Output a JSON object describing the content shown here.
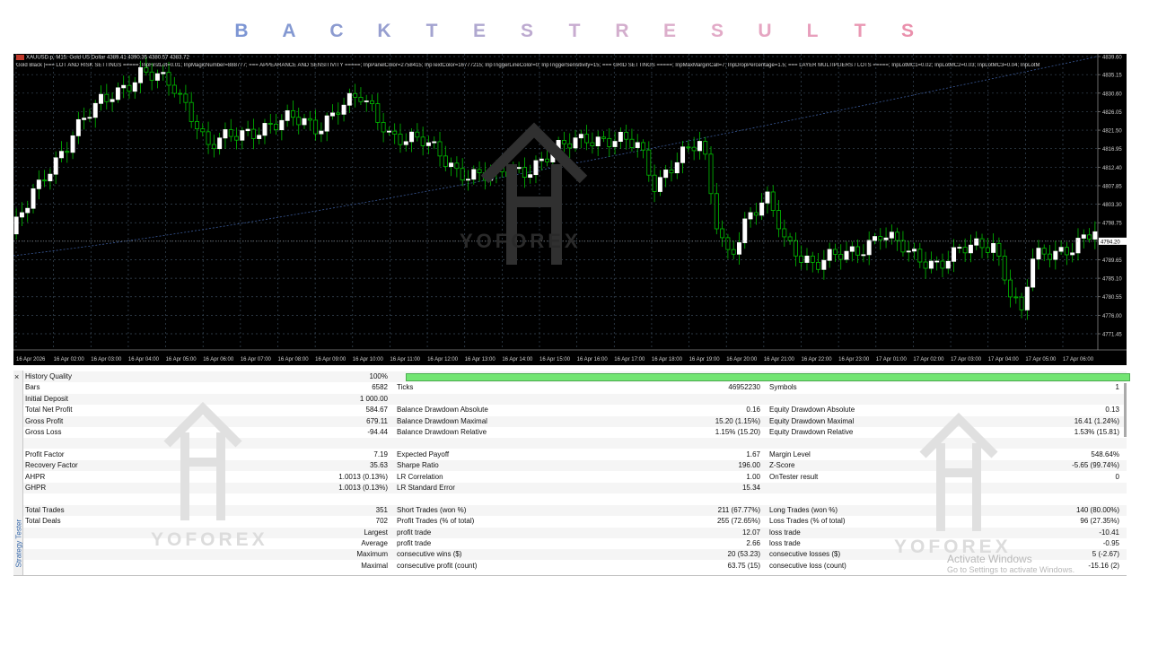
{
  "banner": {
    "letters": [
      "B",
      "A",
      "C",
      "K",
      "T",
      "E",
      "S",
      "T",
      "R",
      "E",
      "S",
      "U",
      "L",
      "T",
      "S"
    ],
    "colors": [
      "#7d96d4",
      "#8499d2",
      "#8c9bd0",
      "#979fd0",
      "#a3a3d0",
      "#b0a8d0",
      "#bdaad0",
      "#c8acd0",
      "#d3aecd",
      "#dcaecb",
      "#e2aac7",
      "#e6a6c2",
      "#e89fbc",
      "#ea98b4",
      "#ea90ac"
    ]
  },
  "chart": {
    "header": "XAUUSD.p, M15:  Gold US Dollar  4389.41 4390.35 4380.57 4383.72",
    "params": "Gold Black |=== LOT AND RISK SETTINGS =====; InpFirstLot=0.01; InpMagicNumber=888777; === APPEARANCE AND SENSITIVITY =====; InpPanelColor=2758415; InpTextColor=16777215; InpTriggerLineColor=0; InpTriggerSensitivity=15; === GRID SETTINGS =====; InpMaxMarginCall=7; InpDropPercentage=1.5; === LAYER MULTIPLIERS / LOTS =====; InpLotMC1=0.02; InpLotMC2=0.03; InpLotMC3=0.04; InpLotM",
    "price_labels": [
      "4839.60",
      "4835.15",
      "4830.60",
      "4826.05",
      "4821.50",
      "4816.95",
      "4812.40",
      "4807.85",
      "4803.30",
      "4798.75",
      "4794.20",
      "4789.65",
      "4785.10",
      "4780.55",
      "4776.00",
      "4771.45"
    ],
    "current_price": "4794.20",
    "time_labels": [
      "16 Apr 2026",
      "16 Apr 02:00",
      "16 Apr 03:00",
      "16 Apr 04:00",
      "16 Apr 05:00",
      "16 Apr 06:00",
      "16 Apr 07:00",
      "16 Apr 08:00",
      "16 Apr 09:00",
      "16 Apr 10:00",
      "16 Apr 11:00",
      "16 Apr 12:00",
      "16 Apr 13:00",
      "16 Apr 14:00",
      "16 Apr 15:00",
      "16 Apr 16:00",
      "16 Apr 17:00",
      "16 Apr 18:00",
      "16 Apr 19:00",
      "16 Apr 20:00",
      "16 Apr 21:00",
      "16 Apr 22:00",
      "16 Apr 23:00",
      "17 Apr 01:00",
      "17 Apr 02:00",
      "17 Apr 03:00",
      "17 Apr 04:00",
      "17 Apr 05:00",
      "17 Apr 06:00"
    ],
    "colors": {
      "background": "#000000",
      "grid": "#3a4a5a",
      "bull": "#ffffff",
      "bear_border": "#00c000",
      "wick": "#00c000",
      "ma": "#3a5a9a"
    },
    "watermark": "YOFOREX"
  },
  "tester": {
    "side_label": "Strategy Tester",
    "rows": [
      {
        "l1": "History Quality",
        "v1": "100%",
        "bar": true
      },
      {
        "l1": "Bars",
        "v1": "6582",
        "l2": "Ticks",
        "v2": "46952230",
        "l3": "Symbols",
        "v3": "1"
      },
      {
        "l1": "Initial Deposit",
        "v1": "1 000.00"
      },
      {
        "l1": "Total Net Profit",
        "v1": "584.67",
        "l2": "Balance Drawdown Absolute",
        "v2": "0.16",
        "l3": "Equity Drawdown Absolute",
        "v3": "0.13"
      },
      {
        "l1": "Gross Profit",
        "v1": "679.11",
        "l2": "Balance Drawdown Maximal",
        "v2": "15.20 (1.15%)",
        "l3": "Equity Drawdown Maximal",
        "v3": "16.41 (1.24%)"
      },
      {
        "l1": "Gross Loss",
        "v1": "-94.44",
        "l2": "Balance Drawdown Relative",
        "v2": "1.15% (15.20)",
        "l3": "Equity Drawdown Relative",
        "v3": "1.53% (15.81)"
      },
      {},
      {
        "l1": "Profit Factor",
        "v1": "7.19",
        "l2": "Expected Payoff",
        "v2": "1.67",
        "l3": "Margin Level",
        "v3": "548.64%"
      },
      {
        "l1": "Recovery Factor",
        "v1": "35.63",
        "l2": "Sharpe Ratio",
        "v2": "196.00",
        "l3": "Z-Score",
        "v3": "-5.65 (99.74%)"
      },
      {
        "l1": "AHPR",
        "v1": "1.0013 (0.13%)",
        "l2": "LR Correlation",
        "v2": "1.00",
        "l3": "OnTester result",
        "v3": "0"
      },
      {
        "l1": "GHPR",
        "v1": "1.0013 (0.13%)",
        "l2": "LR Standard Error",
        "v2": "15.34"
      },
      {},
      {
        "l1": "Total Trades",
        "v1": "351",
        "l2": "Short Trades (won %)",
        "v2": "211 (67.77%)",
        "l3": "Long Trades (won %)",
        "v3": "140 (80.00%)"
      },
      {
        "l1": "Total Deals",
        "v1": "702",
        "l2": "Profit Trades (% of total)",
        "v2": "255 (72.65%)",
        "l3": "Loss Trades (% of total)",
        "v3": "96 (27.35%)"
      },
      {
        "v1": "Largest",
        "l2": "profit trade",
        "v2": "12.07",
        "l3": "loss trade",
        "v3": "-10.41"
      },
      {
        "v1": "Average",
        "l2": "profit trade",
        "v2": "2.66",
        "l3": "loss trade",
        "v3": "-0.95"
      },
      {
        "v1": "Maximum",
        "l2": "consecutive wins ($)",
        "v2": "20 (53.23)",
        "l3": "consecutive losses ($)",
        "v3": "5 (-2.67)"
      },
      {
        "v1": "Maximal",
        "l2": "consecutive profit (count)",
        "v2": "63.75 (15)",
        "l3": "consecutive loss (count)",
        "v3": "-15.16 (2)"
      }
    ],
    "watermark": "YOFOREX"
  },
  "activate": {
    "title": "Activate Windows",
    "subtitle": "Go to Settings to activate Windows."
  }
}
